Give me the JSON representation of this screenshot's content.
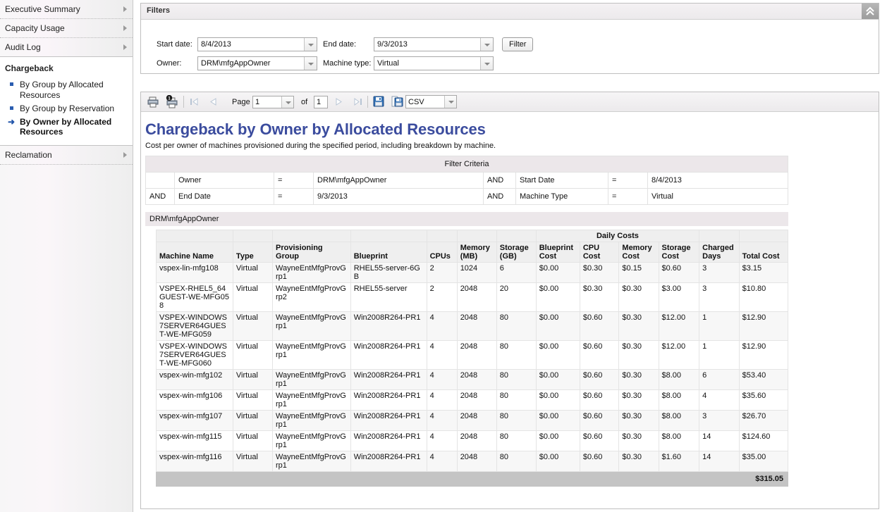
{
  "sidebar": {
    "groups": [
      {
        "label": "Executive Summary",
        "icon": "chevron-right-icon"
      },
      {
        "label": "Capacity Usage",
        "icon": "chevron-right-icon"
      },
      {
        "label": "Audit Log",
        "icon": "chevron-right-icon"
      }
    ],
    "open_panel": {
      "title": "Chargeback",
      "items": [
        {
          "label": "By Group by Allocated Resources",
          "selected": false,
          "marker": "bullet"
        },
        {
          "label": "By Group by Reservation",
          "selected": false,
          "marker": "bullet"
        },
        {
          "label": "By Owner by Allocated Resources",
          "selected": true,
          "marker": "arrow-right-icon"
        }
      ]
    },
    "bottom_groups": [
      {
        "label": "Reclamation",
        "icon": "chevron-right-icon"
      }
    ]
  },
  "filters": {
    "title": "Filters",
    "collapse_icon": "chevrons-up-icon",
    "start_date_label": "Start date:",
    "start_date_value": "8/4/2013",
    "end_date_label": "End date:",
    "end_date_value": "9/3/2013",
    "owner_label": "Owner:",
    "owner_value": "DRM\\mfgAppOwner",
    "machine_type_label": "Machine type:",
    "machine_type_value": "Virtual",
    "filter_button": "Filter"
  },
  "toolbar": {
    "print_icon": "printer-icon",
    "print_current_icon": "printer-page-icon",
    "first_page_icon": "first-page-icon",
    "prev_page_icon": "prev-page-icon",
    "page_label": "Page",
    "page_value": "1",
    "of_label": "of",
    "total_pages": "1",
    "next_page_icon": "next-page-icon",
    "last_page_icon": "last-page-icon",
    "save_icon": "save-icon",
    "export_icon": "export-icon",
    "format_value": "CSV"
  },
  "report": {
    "title": "Chargeback by Owner by Allocated Resources",
    "subtitle": "Cost per owner of machines provisioned during the specified period, including breakdown by machine.",
    "filter_criteria": {
      "title": "Filter Criteria",
      "rows": [
        [
          "",
          "Owner",
          "=",
          "DRM\\mfgAppOwner",
          "AND",
          "Start Date",
          "=",
          "8/4/2013"
        ],
        [
          "AND",
          "End Date",
          "=",
          "9/3/2013",
          "AND",
          "Machine Type",
          "=",
          "Virtual"
        ]
      ]
    },
    "owner_band": "DRM\\mfgAppOwner",
    "table": {
      "group_header": "Daily Costs",
      "headers": [
        "Machine Name",
        "Type",
        "Provisioning Group",
        "Blueprint",
        "CPUs",
        "Memory (MB)",
        "Storage (GB)",
        "Blueprint Cost",
        "CPU Cost",
        "Memory Cost",
        "Storage Cost",
        "Charged Days",
        "Total Cost"
      ],
      "rows": [
        {
          "machine_name": "vspex-lin-mfg108",
          "type": "Virtual",
          "provisioning_group": "WayneEntMfgProvGrp1",
          "blueprint": "RHEL55-server-6GB",
          "cpus": "2",
          "memory_mb": "1024",
          "storage_gb": "6",
          "blueprint_cost": "$0.00",
          "cpu_cost": "$0.30",
          "memory_cost": "$0.15",
          "storage_cost": "$0.60",
          "charged_days": "3",
          "total_cost": "$3.15"
        },
        {
          "machine_name": "VSPEX-RHEL5_64GUEST-WE-MFG058",
          "type": "Virtual",
          "provisioning_group": "WayneEntMfgProvGrp2",
          "blueprint": "RHEL55-server",
          "cpus": "2",
          "memory_mb": "2048",
          "storage_gb": "20",
          "blueprint_cost": "$0.00",
          "cpu_cost": "$0.30",
          "memory_cost": "$0.30",
          "storage_cost": "$3.00",
          "charged_days": "3",
          "total_cost": "$10.80"
        },
        {
          "machine_name": "VSPEX-WINDOWS7SERVER64GUEST-WE-MFG059",
          "type": "Virtual",
          "provisioning_group": "WayneEntMfgProvGrp1",
          "blueprint": "Win2008R264-PR1",
          "cpus": "4",
          "memory_mb": "2048",
          "storage_gb": "80",
          "blueprint_cost": "$0.00",
          "cpu_cost": "$0.60",
          "memory_cost": "$0.30",
          "storage_cost": "$12.00",
          "charged_days": "1",
          "total_cost": "$12.90"
        },
        {
          "machine_name": "VSPEX-WINDOWS7SERVER64GUEST-WE-MFG060",
          "type": "Virtual",
          "provisioning_group": "WayneEntMfgProvGrp1",
          "blueprint": "Win2008R264-PR1",
          "cpus": "4",
          "memory_mb": "2048",
          "storage_gb": "80",
          "blueprint_cost": "$0.00",
          "cpu_cost": "$0.60",
          "memory_cost": "$0.30",
          "storage_cost": "$12.00",
          "charged_days": "1",
          "total_cost": "$12.90"
        },
        {
          "machine_name": "vspex-win-mfg102",
          "type": "Virtual",
          "provisioning_group": "WayneEntMfgProvGrp1",
          "blueprint": "Win2008R264-PR1",
          "cpus": "4",
          "memory_mb": "2048",
          "storage_gb": "80",
          "blueprint_cost": "$0.00",
          "cpu_cost": "$0.60",
          "memory_cost": "$0.30",
          "storage_cost": "$8.00",
          "charged_days": "6",
          "total_cost": "$53.40"
        },
        {
          "machine_name": "vspex-win-mfg106",
          "type": "Virtual",
          "provisioning_group": "WayneEntMfgProvGrp1",
          "blueprint": "Win2008R264-PR1",
          "cpus": "4",
          "memory_mb": "2048",
          "storage_gb": "80",
          "blueprint_cost": "$0.00",
          "cpu_cost": "$0.60",
          "memory_cost": "$0.30",
          "storage_cost": "$8.00",
          "charged_days": "4",
          "total_cost": "$35.60"
        },
        {
          "machine_name": "vspex-win-mfg107",
          "type": "Virtual",
          "provisioning_group": "WayneEntMfgProvGrp1",
          "blueprint": "Win2008R264-PR1",
          "cpus": "4",
          "memory_mb": "2048",
          "storage_gb": "80",
          "blueprint_cost": "$0.00",
          "cpu_cost": "$0.60",
          "memory_cost": "$0.30",
          "storage_cost": "$8.00",
          "charged_days": "3",
          "total_cost": "$26.70"
        },
        {
          "machine_name": "vspex-win-mfg115",
          "type": "Virtual",
          "provisioning_group": "WayneEntMfgProvGrp1",
          "blueprint": "Win2008R264-PR1",
          "cpus": "4",
          "memory_mb": "2048",
          "storage_gb": "80",
          "blueprint_cost": "$0.00",
          "cpu_cost": "$0.60",
          "memory_cost": "$0.30",
          "storage_cost": "$8.00",
          "charged_days": "14",
          "total_cost": "$124.60"
        },
        {
          "machine_name": "vspex-win-mfg116",
          "type": "Virtual",
          "provisioning_group": "WayneEntMfgProvGrp1",
          "blueprint": "Win2008R264-PR1",
          "cpus": "4",
          "memory_mb": "2048",
          "storage_gb": "80",
          "blueprint_cost": "$0.00",
          "cpu_cost": "$0.60",
          "memory_cost": "$0.30",
          "storage_cost": "$1.60",
          "charged_days": "14",
          "total_cost": "$35.00"
        }
      ],
      "total": "$315.05"
    }
  },
  "colors": {
    "title_blue": "#3b4c9e",
    "accent_blue": "#2a5db0",
    "band_gray": "#ece7ea",
    "total_gray": "#c4c4c4"
  }
}
